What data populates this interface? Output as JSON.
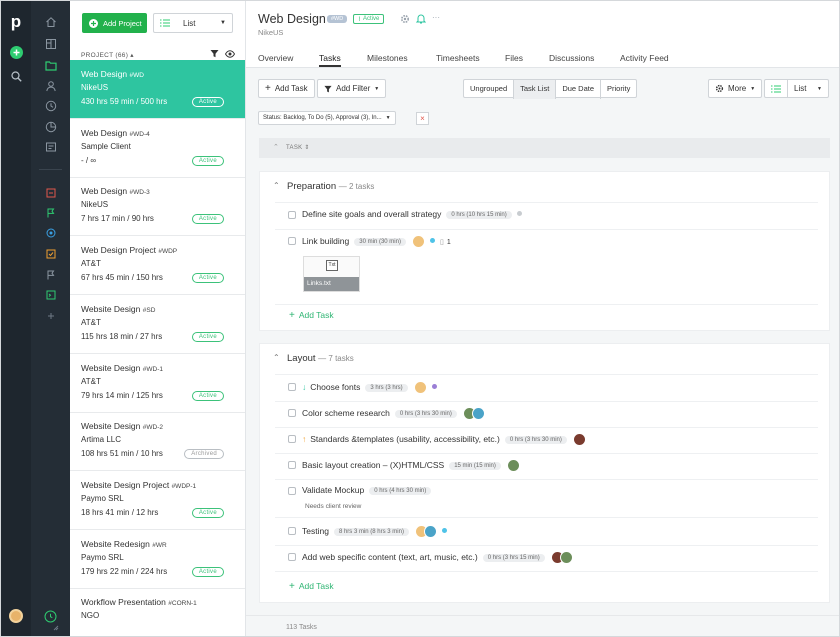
{
  "nav": {
    "logo": "p"
  },
  "toolbar": {
    "add_project": "Add Project",
    "view_select": "List"
  },
  "project_list": {
    "header": "PROJECT (66) ▴",
    "items": [
      {
        "name": "Web Design",
        "code": "#WD",
        "client": "NikeUS",
        "hours": "430 hrs 59 min / 500 hrs",
        "status": "Active"
      },
      {
        "name": "Web Design",
        "code": "#WD-4",
        "client": "Sample Client",
        "hours": "- / ∞",
        "status": "Active"
      },
      {
        "name": "Web Design",
        "code": "#WD-3",
        "client": "NikeUS",
        "hours": "7 hrs 17 min / 90 hrs",
        "status": "Active"
      },
      {
        "name": "Web Design Project",
        "code": "#WDP",
        "client": "AT&T",
        "hours": "67 hrs 45 min / 150 hrs",
        "status": "Active"
      },
      {
        "name": "Website Design",
        "code": "#SD",
        "client": "AT&T",
        "hours": "115 hrs 18 min / 27 hrs",
        "status": "Active"
      },
      {
        "name": "Website Design",
        "code": "#WD-1",
        "client": "AT&T",
        "hours": "79 hrs 14 min / 125 hrs",
        "status": "Active"
      },
      {
        "name": "Website Design",
        "code": "#WD-2",
        "client": "Artima LLC",
        "hours": "108 hrs 51 min / 10 hrs",
        "status": "Archived"
      },
      {
        "name": "Website Design Project",
        "code": "#WDP-1",
        "client": "Paymo SRL",
        "hours": "18 hrs 41 min / 12 hrs",
        "status": "Active"
      },
      {
        "name": "Website Redesign",
        "code": "#WR",
        "client": "Paymo SRL",
        "hours": "179 hrs 22 min / 224 hrs",
        "status": "Active"
      },
      {
        "name": "Workflow Presentation",
        "code": "#CORN-1",
        "client": "NGO",
        "hours": "",
        "status": ""
      }
    ]
  },
  "project": {
    "title": "Web Design",
    "code": "#WD",
    "status": "Active",
    "client": "NikeUS"
  },
  "tabs": [
    "Overview",
    "Tasks",
    "Milestones",
    "Timesheets",
    "Files",
    "Discussions",
    "Activity Feed"
  ],
  "task_toolbar": {
    "add_task": "Add Task",
    "add_filter": "Add Filter",
    "group_options": [
      "Ungrouped",
      "Task List",
      "Due Date",
      "Priority"
    ],
    "more": "More",
    "view": "List"
  },
  "filter": {
    "label": "Status: Backlog, To Do (5), Approval (3), In..."
  },
  "column_header": "TASK ⇕",
  "groups": [
    {
      "name": "Preparation",
      "count": "— 2 tasks",
      "tasks": [
        {
          "name": "Define site goals and overall strategy",
          "estimate": "0 hrs (10 hrs 15 min)",
          "attachment_count": ""
        },
        {
          "name": "Link building",
          "estimate": "30 min (30 min)",
          "attachment_count": "1"
        }
      ],
      "attachment": {
        "ext": "Txt",
        "filename": "Links.txt"
      },
      "add_task": "Add Task"
    },
    {
      "name": "Layout",
      "count": "— 7 tasks",
      "tasks": [
        {
          "name": "Choose fonts",
          "estimate": "3 hrs (3 hrs)",
          "note": ""
        },
        {
          "name": "Color scheme research",
          "estimate": "0 hrs (3 hrs 30 min)",
          "note": ""
        },
        {
          "name": "Standards &templates (usability, accessibility, etc.)",
          "estimate": "0 hrs (3 hrs 30 min)",
          "note": ""
        },
        {
          "name": "Basic layout creation – (X)HTML/CSS",
          "estimate": "15 min (15 min)",
          "note": ""
        },
        {
          "name": "Validate Mockup",
          "estimate": "0 hrs (4 hrs 30 min)",
          "note": "Needs client review"
        },
        {
          "name": "Testing",
          "estimate": "8 hrs 3 min (8 hrs 3 min)",
          "note": ""
        },
        {
          "name": "Add web specific content (text, art, music, etc.)",
          "estimate": "0 hrs (3 hrs 15 min)",
          "note": ""
        }
      ],
      "add_task": "Add Task"
    }
  ],
  "footer": {
    "count": "113 Tasks"
  },
  "colors": {
    "accent": "#2ec5a0",
    "green": "#3cc27a",
    "rail": "#1e262e"
  }
}
